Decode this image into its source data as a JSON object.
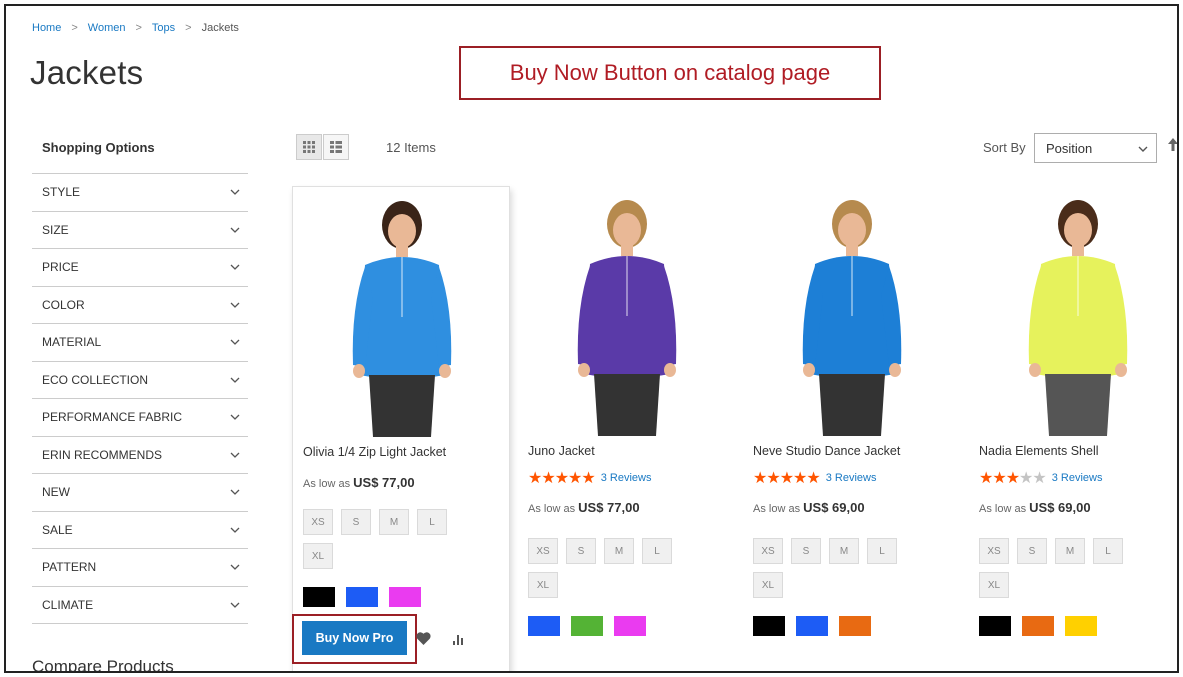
{
  "breadcrumb": [
    {
      "label": "Home"
    },
    {
      "label": "Women"
    },
    {
      "label": "Tops"
    },
    {
      "label": "Jackets"
    }
  ],
  "breadcrumb_sep": ">",
  "page_title": "Jackets",
  "annotation": "Buy Now Button on catalog page",
  "sidebar": {
    "title": "Shopping Options",
    "filters": [
      "STYLE",
      "SIZE",
      "PRICE",
      "COLOR",
      "MATERIAL",
      "ECO COLLECTION",
      "PERFORMANCE FABRIC",
      "ERIN RECOMMENDS",
      "NEW",
      "SALE",
      "PATTERN",
      "CLIMATE"
    ],
    "compare_title": "Compare Products"
  },
  "toolbar": {
    "items_count": "12 Items",
    "sort_label": "Sort By",
    "sort_value": "Position"
  },
  "products": [
    {
      "name": "Olivia 1/4 Zip Light Jacket",
      "price_prefix": "As low as",
      "price": "US$ 77,00",
      "rating": null,
      "reviews": "",
      "sizes": [
        "XS",
        "S",
        "M",
        "L",
        "XL"
      ],
      "swatches": [
        "#000000",
        "#1d5cf5",
        "#ea3bf0"
      ],
      "jacket_color": "#2f8fe0"
    },
    {
      "name": "Juno Jacket",
      "price_prefix": "As low as",
      "price": "US$ 77,00",
      "rating": 4.5,
      "reviews": "3 Reviews",
      "sizes": [
        "XS",
        "S",
        "M",
        "L",
        "XL"
      ],
      "swatches": [
        "#1d5cf5",
        "#54b335",
        "#ea3bf0"
      ],
      "jacket_color": "#5a3aa8"
    },
    {
      "name": "Neve Studio Dance Jacket",
      "price_prefix": "As low as",
      "price": "US$ 69,00",
      "rating": 4.5,
      "reviews": "3 Reviews",
      "sizes": [
        "XS",
        "S",
        "M",
        "L",
        "XL"
      ],
      "swatches": [
        "#000000",
        "#1d5cf5",
        "#e86a12"
      ],
      "jacket_color": "#1d7fd6"
    },
    {
      "name": "Nadia Elements Shell",
      "price_prefix": "As low as",
      "price": "US$ 69,00",
      "rating": 3,
      "reviews": "3 Reviews",
      "sizes": [
        "XS",
        "S",
        "M",
        "L",
        "XL"
      ],
      "swatches": [
        "#000000",
        "#e86a12",
        "#ffd000"
      ],
      "jacket_color": "#e6f25c"
    }
  ],
  "buy_button": "Buy Now Pro",
  "colors": {
    "accent": "#1979c3",
    "annotation": "#9b1f25",
    "star": "#ff5501"
  }
}
